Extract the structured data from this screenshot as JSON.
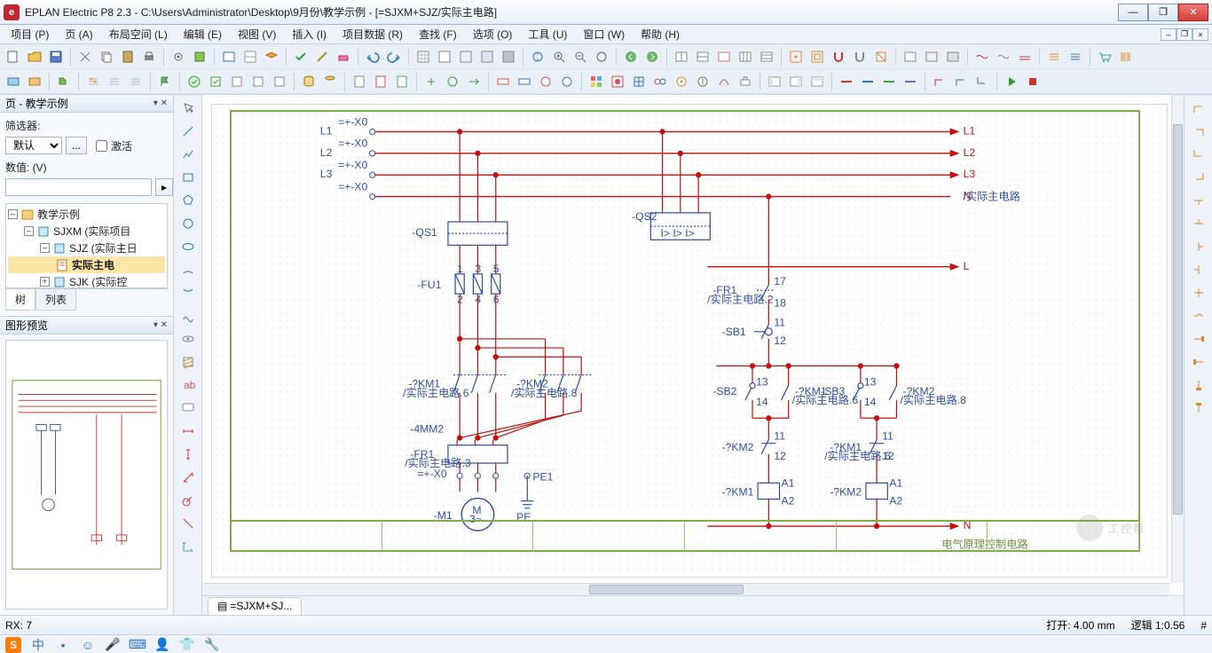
{
  "app": {
    "title": "EPLAN Electric P8 2.3 - C:\\Users\\Administrator\\Desktop\\9月份\\教学示例 - [=SJXM+SJZ/实际主电路]",
    "icon_letter": "e"
  },
  "menu": {
    "items": [
      {
        "label": "项目 (P)"
      },
      {
        "label": "页 (A)"
      },
      {
        "label": "布局空间 (L)"
      },
      {
        "label": "编辑 (E)"
      },
      {
        "label": "视图 (V)"
      },
      {
        "label": "插入 (I)"
      },
      {
        "label": "项目数据 (R)"
      },
      {
        "label": "查找 (F)"
      },
      {
        "label": "选项 (O)"
      },
      {
        "label": "工具 (U)"
      },
      {
        "label": "窗口 (W)"
      },
      {
        "label": "帮助 (H)"
      }
    ]
  },
  "sidebar": {
    "pages_title": "页 - 教学示例",
    "filter_label": "筛选器:",
    "filter_default_option": "默认",
    "filter_button": "...",
    "activate_label": "激活",
    "value_label": "数值: (V)",
    "tree": {
      "root": "教学示例",
      "nodes": [
        {
          "label": "SJXM (实际项目"
        },
        {
          "label": "SJZ (实际主日"
        },
        {
          "label": "实际主电",
          "selected": true
        },
        {
          "label": "SJK (实际控"
        }
      ]
    },
    "tabs": {
      "tree": "树",
      "list": "列表"
    },
    "preview_title": "图形预览"
  },
  "doc_tab": "=SJXM+SJ...",
  "statusbar": {
    "rx": "RX: 7",
    "open": "打开: 4.00  mm",
    "logic": "逻辑  1:0.56",
    "hash": "#"
  },
  "schematic": {
    "rails": [
      "L1",
      "L2",
      "L3",
      "N",
      "L",
      "N"
    ],
    "terminals": {
      "top": [
        "=+-X0",
        "=+-X0",
        "=+-X0",
        "=+-X0"
      ],
      "markers": [
        "1",
        "3",
        "5",
        "2",
        "4",
        "6"
      ]
    },
    "components": {
      "QS1": "-QS1",
      "QS2": "-QS2",
      "FU1": "-FU1",
      "FR1": "-FR1",
      "FR1_ref": "/实际主电路.3",
      "FR1b": "-FR1",
      "FR1b_ref": "/实际主电路.2",
      "KM1": "-?KM1",
      "KM1_ref": "/实际主电路.6",
      "KM2": "-?KM2",
      "KM2_ref": "/实际主电路.8",
      "SB1": "-SB1",
      "SB2": "-SB2",
      "SB3": "-SB3",
      "KM1c": "-?KM1",
      "KM2c": "-?KM2",
      "KM1d": "-?KM1",
      "KM2d": "-?KM2",
      "cable": "-4MM2",
      "pe": "PE",
      "motor": "-M1",
      "motor_inner": "M\n3~",
      "x0_bottom": "=+-X0",
      "nodes_small": [
        "11",
        "12",
        "13",
        "14",
        "A1",
        "A2",
        "PE1"
      ],
      "right_note": "/实际主电路"
    },
    "watermark": "工控帮"
  }
}
